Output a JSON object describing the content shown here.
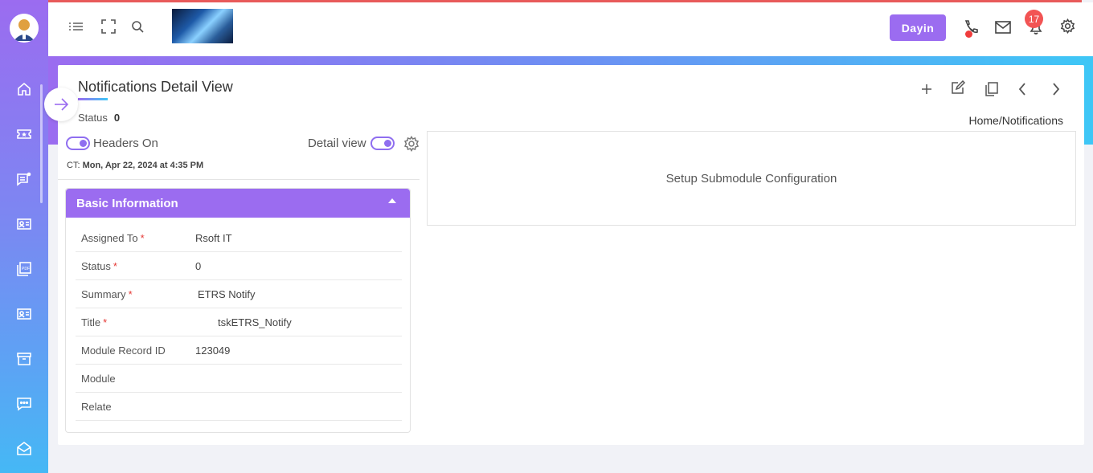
{
  "header": {
    "dayin_label": "Dayin",
    "notification_count": "17",
    "icons": [
      "list-icon",
      "fullscreen-icon",
      "search-icon",
      "phone-icon",
      "mail-icon",
      "bell-icon",
      "gear-icon"
    ]
  },
  "sidebar": {
    "items": [
      "home-icon",
      "ticket-icon",
      "chat-icon",
      "contact-card-icon",
      "pdf-icon",
      "id-card-icon",
      "archive-icon",
      "message-icon",
      "mail-open-icon"
    ]
  },
  "page": {
    "title": "Notifications Detail View",
    "status_label": "Status",
    "status_value": "0",
    "breadcrumb": "Home/Notifications",
    "headers_toggle_label": "Headers On",
    "detail_view_label": "Detail view",
    "ct_prefix": "CT:",
    "ct_value": "Mon, Apr 22, 2024 at 4:35 PM"
  },
  "basic_info": {
    "heading": "Basic Information",
    "rows": [
      {
        "label": "Assigned To",
        "required": "*",
        "value": "Rsoft IT"
      },
      {
        "label": "Status",
        "required": "*",
        "value": "0"
      },
      {
        "label": "Summary",
        "required": "*",
        "value": "ETRS Notify"
      },
      {
        "label": "Title",
        "required": "*",
        "value": "tskETRS_Notify"
      },
      {
        "label": "Module Record ID",
        "required": "",
        "value": "123049"
      },
      {
        "label": "Module",
        "required": "",
        "value": ""
      },
      {
        "label": "Relate",
        "required": "",
        "value": ""
      }
    ]
  },
  "submodule": {
    "message": "Setup Submodule Configuration"
  },
  "colors": {
    "accent": "#9b6cf0",
    "secondary": "#3ec7f6",
    "badge": "#f25454"
  }
}
